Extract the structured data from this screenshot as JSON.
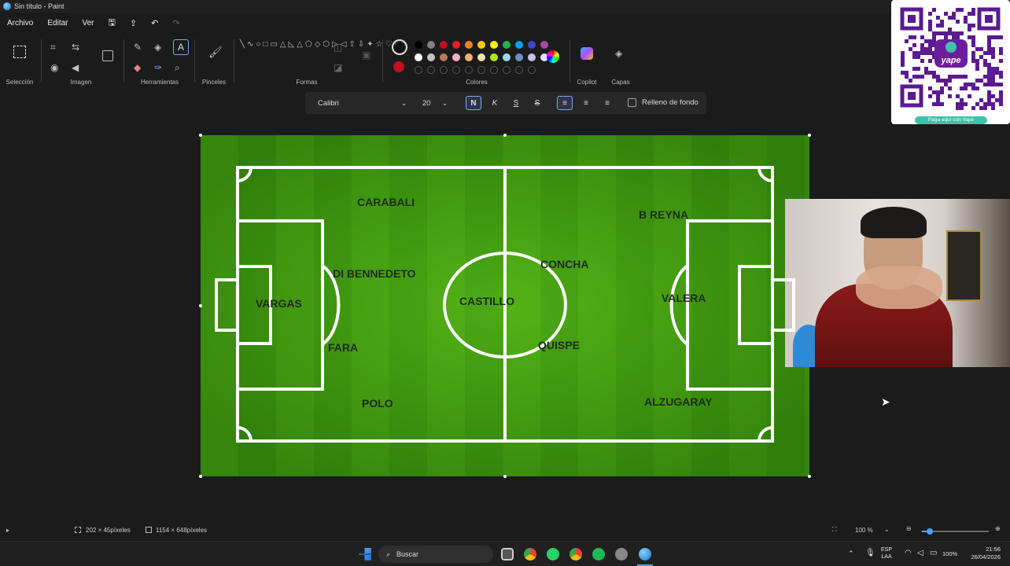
{
  "window": {
    "title": "Sin título - Paint"
  },
  "menu": {
    "items": [
      "Archivo",
      "Editar",
      "Ver"
    ]
  },
  "ribbon": {
    "groups": [
      "Selección",
      "Imagen",
      "Herramientas",
      "Pinceles",
      "Formas",
      "Colores",
      "Copilot",
      "Capas"
    ]
  },
  "colors": {
    "row1": [
      "#000000",
      "#7f7f7f",
      "#c0111f",
      "#ed1c24",
      "#ff7f27",
      "#ffc90e",
      "#fff200",
      "#22b14c",
      "#00a2e8",
      "#3f48cc",
      "#a349a4"
    ],
    "row2": [
      "#ffffff",
      "#c3c3c3",
      "#b97a57",
      "#ffaec9",
      "#ffb069",
      "#efe4b0",
      "#b5e61d",
      "#99d9ea",
      "#7092be",
      "#c8bfe7",
      "#e0e0ff"
    ],
    "primary": "#111111",
    "secondary": "#c0111f"
  },
  "text_toolbar": {
    "font": "Calibri",
    "size": "20",
    "bold_label": "N",
    "italic_label": "K",
    "underline_label": "S",
    "strike_label": "S",
    "background_fill_label": "Relleno de fondo"
  },
  "canvas": {
    "players": [
      {
        "id": "carabali",
        "name": "CARABALI"
      },
      {
        "id": "dibennedeto",
        "name": "DI BENNEDETO"
      },
      {
        "id": "vargas",
        "name": "VARGAS"
      },
      {
        "id": "fara",
        "name": "FARA"
      },
      {
        "id": "polo",
        "name": "POLO"
      },
      {
        "id": "castillo",
        "name": "CASTILLO"
      },
      {
        "id": "concha",
        "name": "CONCHA"
      },
      {
        "id": "quispe",
        "name": "QUISPE"
      },
      {
        "id": "breyna",
        "name": "B REYNA"
      },
      {
        "id": "valera",
        "name": "VALERA"
      },
      {
        "id": "alzugaray",
        "name": "ALZUGARAY"
      }
    ]
  },
  "qr": {
    "brand": "yape",
    "caption": "Paga aquí con Yape"
  },
  "status": {
    "selection_size": "202 × 45píxeles",
    "canvas_size": "1154 × 648píxeles",
    "zoom": "100 %"
  },
  "taskbar": {
    "search_placeholder": "Buscar",
    "lang_line1": "ESP",
    "lang_line2": "LAA",
    "battery": "100%",
    "time": "21:56",
    "date": "26/04/2026"
  }
}
